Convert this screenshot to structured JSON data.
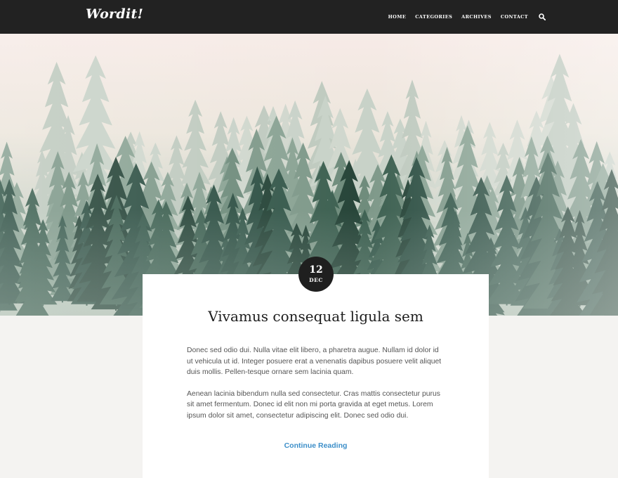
{
  "site": {
    "logo": "Wordit!"
  },
  "nav": {
    "items": [
      "HOME",
      "CATEGORIES",
      "ARCHIVES",
      "CONTACT"
    ],
    "search_icon": "search-icon"
  },
  "hero": {
    "image": "misty pine forest",
    "colors": {
      "sky": "#f6ebe6",
      "forest_dark": "#23443a",
      "forest_mid": "#557866"
    }
  },
  "post": {
    "date_day": "12",
    "date_month": "DEC",
    "title": "Vivamus consequat ligula sem",
    "paragraphs": [
      "Donec sed odio dui. Nulla vitae elit libero, a pharetra augue. Nullam id dolor id ut vehicula ut id. Integer posuere erat a venenatis dapibus posuere velit aliquet duis mollis. Pellen-tesque ornare sem lacinia quam.",
      "Aenean lacinia bibendum nulla sed consectetur. Cras mattis consectetur purus sit amet fermentum. Donec id elit non mi porta gravida at eget metus. Lorem ipsum dolor sit amet, consectetur adipiscing elit. Donec sed odio dui."
    ],
    "continue_label": "Continue Reading"
  }
}
